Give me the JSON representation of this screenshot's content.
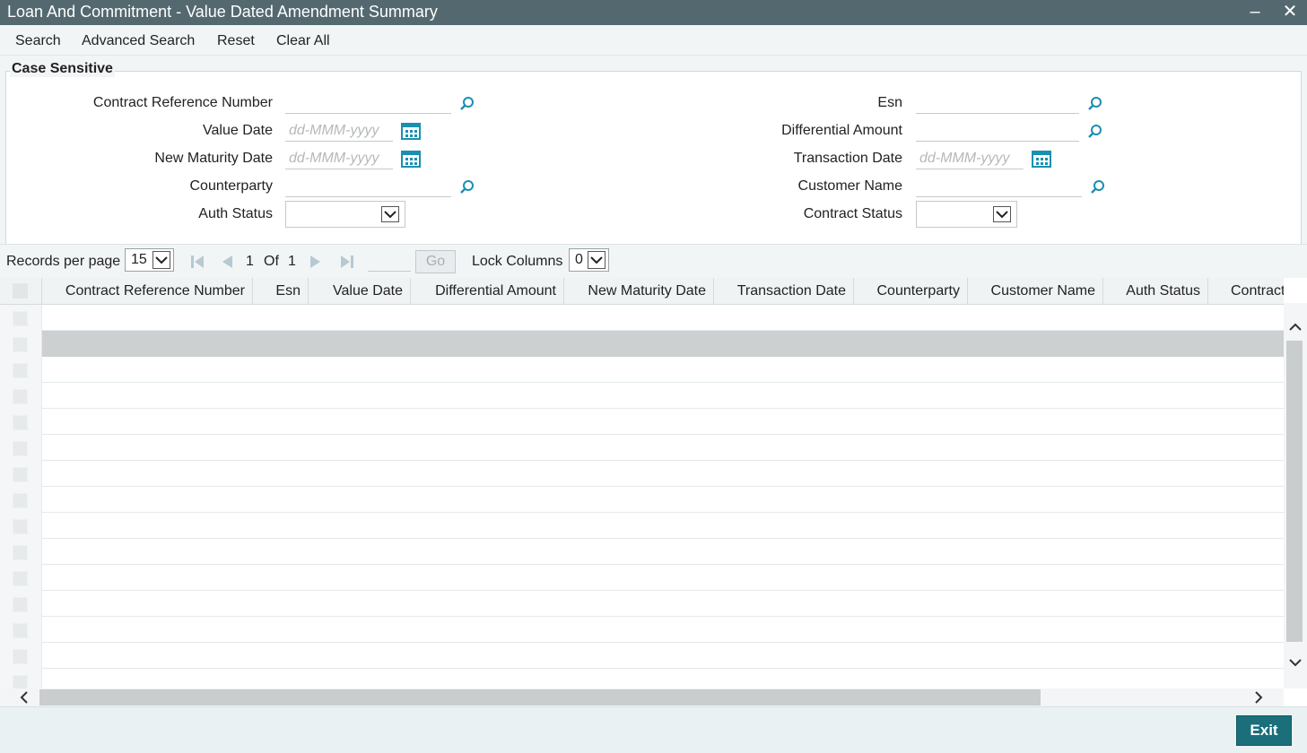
{
  "window": {
    "title": "Loan And Commitment - Value Dated Amendment Summary",
    "minimize_glyph": "–",
    "close_glyph": "✕"
  },
  "toolbar": {
    "search": "Search",
    "advanced_search": "Advanced Search",
    "reset": "Reset",
    "clear_all": "Clear All"
  },
  "criteria": {
    "legend": "Case Sensitive",
    "contract_ref": {
      "label": "Contract Reference Number",
      "value": ""
    },
    "value_date": {
      "label": "Value Date",
      "placeholder": "dd-MMM-yyyy"
    },
    "new_maturity_date": {
      "label": "New Maturity Date",
      "placeholder": "dd-MMM-yyyy"
    },
    "counterparty": {
      "label": "Counterparty",
      "value": ""
    },
    "auth_status": {
      "label": "Auth Status",
      "value": ""
    },
    "esn": {
      "label": "Esn",
      "value": ""
    },
    "differential_amount": {
      "label": "Differential Amount",
      "value": ""
    },
    "transaction_date": {
      "label": "Transaction Date",
      "placeholder": "dd-MMM-yyyy"
    },
    "customer_name": {
      "label": "Customer Name",
      "value": ""
    },
    "contract_status": {
      "label": "Contract Status",
      "value": ""
    }
  },
  "pager": {
    "records_label": "Records per page",
    "records_value": "15",
    "current_page": "1",
    "of_label": "Of",
    "total_pages": "1",
    "go_label": "Go",
    "lock_label": "Lock Columns",
    "lock_value": "0"
  },
  "grid": {
    "columns": [
      "Contract Reference Number",
      "Esn",
      "Value Date",
      "Differential Amount",
      "New Maturity Date",
      "Transaction Date",
      "Counterparty",
      "Customer Name",
      "Auth Status",
      "Contract"
    ]
  },
  "footer": {
    "exit_label": "Exit"
  },
  "colors": {
    "titlebar": "#54696f",
    "accent_icon": "#1a8fb0",
    "exit_button": "#1a6f7a"
  }
}
